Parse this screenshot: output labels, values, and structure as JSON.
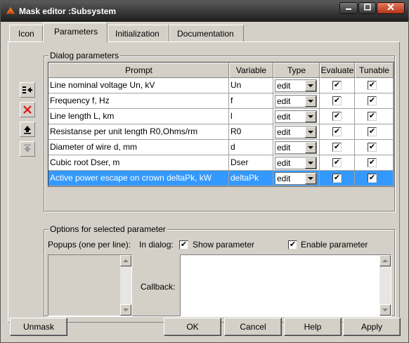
{
  "window": {
    "title": "Mask editor :Subsystem"
  },
  "tabs": [
    {
      "label": "Icon"
    },
    {
      "label": "Parameters"
    },
    {
      "label": "Initialization"
    },
    {
      "label": "Documentation"
    }
  ],
  "dialog_params": {
    "group_label": "Dialog parameters",
    "columns": [
      "Prompt",
      "Variable",
      "Type",
      "Evaluate",
      "Tunable"
    ],
    "rows": [
      {
        "prompt": "Line nominal voltage Un, kV",
        "variable": "Un",
        "type": "edit",
        "evaluate": true,
        "tunable": true
      },
      {
        "prompt": "Frequency f, Hz",
        "variable": "f",
        "type": "edit",
        "evaluate": true,
        "tunable": true
      },
      {
        "prompt": "Line length L, km",
        "variable": "l",
        "type": "edit",
        "evaluate": true,
        "tunable": true
      },
      {
        "prompt": "Resistanse per unit length R0,Ohms/rm",
        "variable": "R0",
        "type": "edit",
        "evaluate": true,
        "tunable": true
      },
      {
        "prompt": "Diameter of wire d, mm",
        "variable": "d",
        "type": "edit",
        "evaluate": true,
        "tunable": true
      },
      {
        "prompt": "Cubic root Dser, m",
        "variable": "Dser",
        "type": "edit",
        "evaluate": true,
        "tunable": true
      },
      {
        "prompt": "Active power escape on  crown deltaPk, kW",
        "variable": "deltaPk",
        "type": "edit",
        "evaluate": true,
        "tunable": true
      }
    ],
    "selected_row": 6
  },
  "options": {
    "group_label": "Options for selected parameter",
    "popups_label": "Popups (one per line):",
    "in_dialog_label": "In dialog:",
    "show_parameter_label": "Show parameter",
    "show_parameter": true,
    "enable_parameter_label": "Enable parameter",
    "enable_parameter": true,
    "callback_label": "Callback:"
  },
  "buttons": {
    "unmask": "Unmask",
    "ok": "OK",
    "cancel": "Cancel",
    "help": "Help",
    "apply": "Apply"
  },
  "colors": {
    "selection": "#3399ff",
    "window_bg": "#d4d0c8",
    "delete_icon": "#e01010"
  },
  "icons": {
    "side_buttons": [
      "insert-parameter-icon",
      "delete-parameter-icon",
      "move-up-icon",
      "move-down-icon"
    ]
  }
}
